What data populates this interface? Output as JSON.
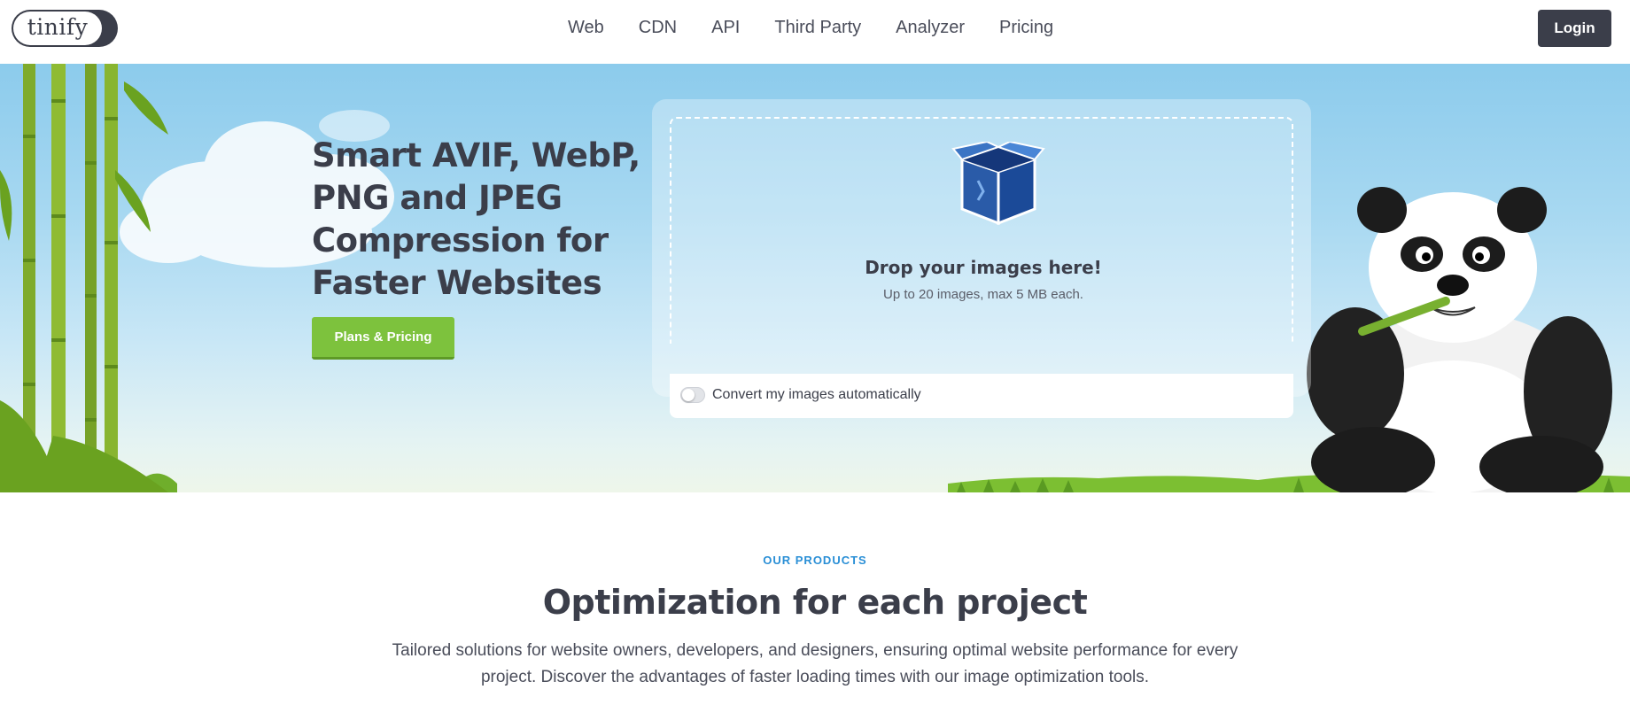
{
  "header": {
    "logo_text": "tinify",
    "nav": [
      {
        "label": "Web"
      },
      {
        "label": "CDN"
      },
      {
        "label": "API"
      },
      {
        "label": "Third Party"
      },
      {
        "label": "Analyzer"
      },
      {
        "label": "Pricing"
      }
    ],
    "login_label": "Login"
  },
  "hero": {
    "title": "Smart AVIF, WebP, PNG and JPEG Compression for Faster Websites",
    "cta_label": "Plans & Pricing",
    "dropzone": {
      "title": "Drop your images here!",
      "subtitle": "Up to 20 images, max 5 MB each.",
      "convert_label": "Convert my images automatically",
      "convert_enabled": false
    }
  },
  "products": {
    "eyebrow": "OUR PRODUCTS",
    "title": "Optimization for each project",
    "description": "Tailored solutions for website owners, developers, and designers, ensuring optimal website performance for every project. Discover the advantages of faster loading times with our image optimization tools."
  },
  "colors": {
    "brand_dark": "#3b3e4a",
    "cta_green": "#7dc23d",
    "eyebrow_blue": "#2a8fd6",
    "sky_top": "#8ccbec"
  },
  "icons": [
    "box-icon",
    "panda-mascot",
    "bamboo-decoration",
    "cloud-decoration",
    "grass-decoration"
  ]
}
